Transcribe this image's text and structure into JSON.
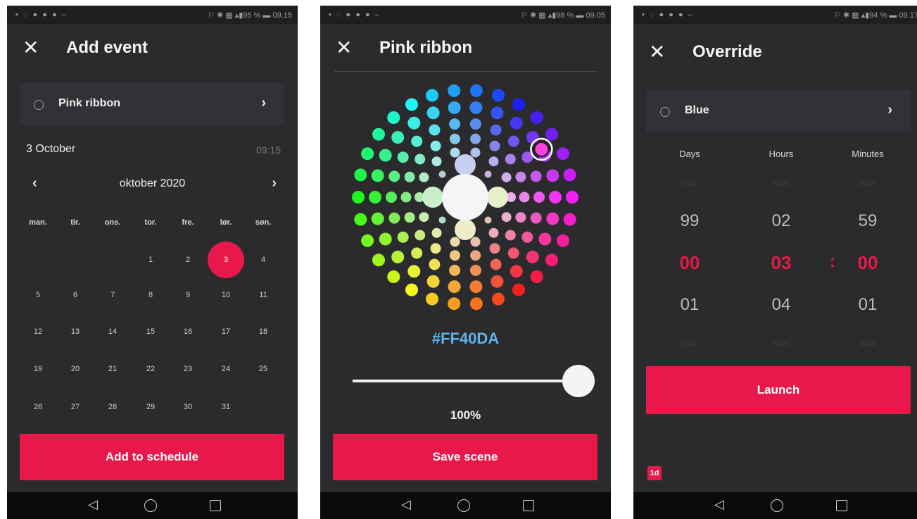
{
  "screen1": {
    "status": {
      "icons": "▪ ◌ ● ● ● –",
      "right": "⚐ ✱ ▦ ▴▮95 % ▬ 09.15"
    },
    "title": "Add event",
    "selected_scene": "Pink ribbon",
    "date_label": "3 October",
    "time_label": "09:15",
    "month_label": "oktober 2020",
    "weekdays": [
      "man.",
      "tir.",
      "ons.",
      "tor.",
      "fre.",
      "lør.",
      "søn."
    ],
    "days": [
      "1",
      "2",
      "3",
      "4",
      "5",
      "6",
      "7",
      "8",
      "9",
      "10",
      "11",
      "12",
      "13",
      "14",
      "15",
      "16",
      "17",
      "18",
      "19",
      "20",
      "21",
      "22",
      "23",
      "24",
      "25",
      "26",
      "27",
      "28",
      "29",
      "30",
      "31"
    ],
    "selected_day": "3",
    "cta": "Add to schedule"
  },
  "screen2": {
    "status": {
      "icons": "▪ ◌ ● ● ● –",
      "right": "⚐ ✱ ▦ ▴▮98 % ▬ 09.05"
    },
    "title": "Pink ribbon",
    "selected_color": "#FF40DA",
    "hex_label": "#FF40DA",
    "brightness": 100,
    "brightness_label": "100%",
    "cta": "Save scene"
  },
  "screen3": {
    "status": {
      "icons": "▪ ◌ ● ● ● –",
      "right": "⚐ ✱ ▦ ▴▮94 % ▬ 09.17"
    },
    "title": "Override",
    "selected_scene": "Blue",
    "columns": [
      "Days",
      "Hours",
      "Minutes"
    ],
    "above": [
      "99",
      "02",
      "59"
    ],
    "current": [
      "00",
      "03",
      "00"
    ],
    "separator": ":",
    "below": [
      "01",
      "04",
      "01"
    ],
    "cta": "Launch",
    "badge": "1d"
  },
  "colors": {
    "accent": "#e8194a",
    "background": "#2b2b2e",
    "row": "#323236",
    "hex_text": "#5bb4ea"
  },
  "icons": {
    "close": "close-icon",
    "chevron": "chevron-right-icon",
    "radio": "radio-icon",
    "back": "back-icon",
    "home": "home-icon",
    "recents": "recents-icon"
  },
  "nav": {
    "back": "◁",
    "close": "✕",
    "prev": "‹",
    "next": "›"
  }
}
